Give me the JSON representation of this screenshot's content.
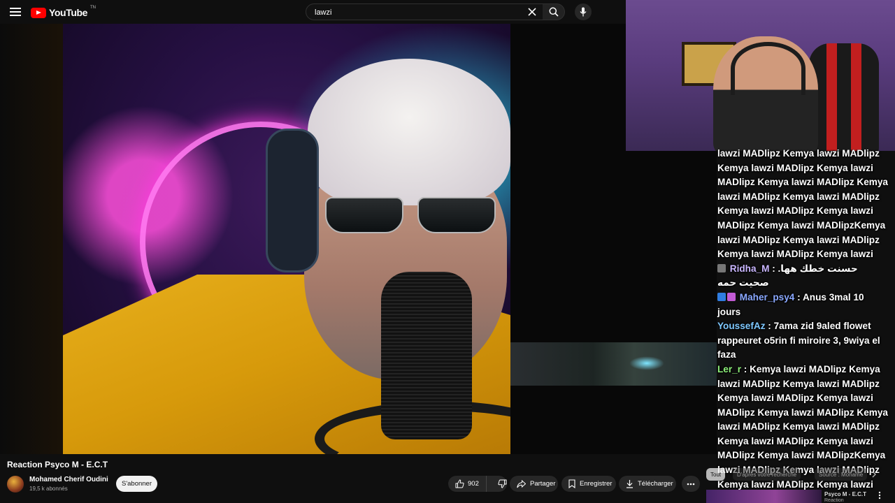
{
  "masthead": {
    "logo_text": "YouTube",
    "logo_cc": "TN",
    "search_value": "lawzi"
  },
  "video": {
    "title": "Reaction Psyco M - E.C.T"
  },
  "channel": {
    "name": "Mohamed Cherif Oudini",
    "subscribers": "19,5 k abonnés",
    "subscribe_label": "S'abonner"
  },
  "actions": {
    "likes": "902",
    "share_label": "Partager",
    "save_label": "Enregistrer",
    "download_label": "Télécharger"
  },
  "chips": {
    "all": "Tout",
    "from_search": "D'après votre recherche",
    "source": "Source : Mohame"
  },
  "recommendation": {
    "title": "Psyco M - E.C.T",
    "subtitle": "Reaction"
  },
  "chat": {
    "messages": [
      {
        "author": "",
        "author_color": "#ffffff",
        "text": "lawzi MADlipz Kemya lawzi MADlipz Kemya lawzi MADlipz Kemya lawzi MADlipz Kemya lawzi MADlipz Kemya lawzi MADlipz Kemya lawzi MADlipz Kemya lawzi MADlipz Kemya lawzi MADlipz Kemya lawzi MADlipzKemya lawzi MADlipz Kemya lawzi MADlipz Kemya lawzi MADlipz Kemya lawzi"
      },
      {
        "author": "Ridha_M",
        "author_color": "#c9b6ff",
        "text": "حسنت خطك هها. صحيت حمه"
      },
      {
        "author": "Maher_psy4",
        "author_color": "#8aa8ff",
        "text": "Anus 3mal 10 jours"
      },
      {
        "author": "YoussefAz",
        "author_color": "#7ec8ff",
        "text": "7ama zid 9aled flowet rappeuret o5rin fi miroire 3, 9wiya el faza"
      },
      {
        "author": "Ler_r",
        "author_color": "#8df07a",
        "text": "Kemya lawzi MADlipz Kemya lawzi MADlipz Kemya lawzi MADlipz Kemya lawzi MADlipz Kemya lawzi MADlipz Kemya lawzi MADlipz Kemya lawzi MADlipz Kemya lawzi MADlipz Kemya lawzi MADlipz Kemya lawzi MADlipz Kemya lawzi MADlipzKemya lawzi MADlipz Kemya lawzi MADlipz Kemya lawzi MADlipz Kemya lawzi"
      }
    ]
  }
}
